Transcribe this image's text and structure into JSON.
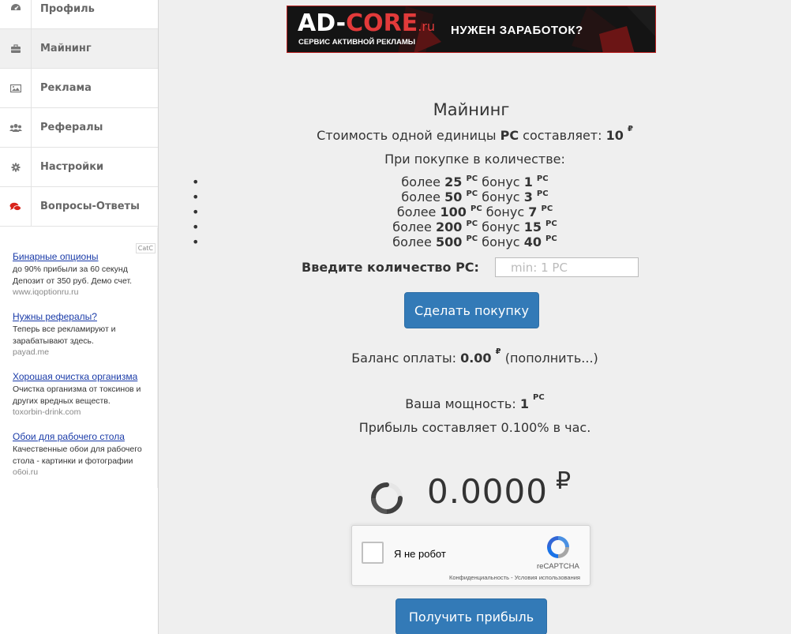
{
  "sidebar": {
    "items": [
      {
        "label": "Профиль",
        "icon": "dashboard-icon"
      },
      {
        "label": "Майнинг",
        "icon": "briefcase-icon"
      },
      {
        "label": "Реклама",
        "icon": "image-icon"
      },
      {
        "label": "Рефералы",
        "icon": "users-icon"
      },
      {
        "label": "Настройки",
        "icon": "gear-icon"
      },
      {
        "label": "Вопросы-Ответы",
        "icon": "chat-icon"
      }
    ]
  },
  "ads": {
    "tag": "CatC",
    "items": [
      {
        "title": "Бинарные опционы",
        "lines": [
          "до 90% прибыли за 60 секунд",
          "Депозит от 350 руб. Демо счет."
        ],
        "url": "www.iqoptionru.ru"
      },
      {
        "title": "Нужны рефералы?",
        "lines": [
          "Теперь все рекламируют и",
          "зарабатывают здесь."
        ],
        "url": "payad.me"
      },
      {
        "title": "Хорошая очистка организма",
        "lines": [
          "Очистка организма от токсинов и",
          "других вредных веществ."
        ],
        "url": "toxorbin-drink.com"
      },
      {
        "title": "Обои для рабочего стола",
        "lines": [
          "Качественные обои для рабочего",
          "стола - картинки и фотографии"
        ],
        "url": "o6oi.ru"
      }
    ]
  },
  "banner": {
    "logo_main": "AD-",
    "logo_accent": "CORE",
    "logo_tld": ".ru",
    "subtitle": "СЕРВИС АКТИВНОЙ РЕКЛАМЫ",
    "cta": "НУЖЕН ЗАРАБОТОК?"
  },
  "main": {
    "title": "Майнинг",
    "cost_prefix": "Стоимость одной единицы",
    "cost_unit": "PC",
    "cost_middle": "составляет:",
    "cost_value": "10",
    "currency": "₽",
    "purchase_intro": "При покупке в количестве:",
    "tier_more": "более",
    "tier_bonus": "бонус",
    "tier_unit": "PC",
    "tiers": [
      {
        "min": "25",
        "bonus": "1"
      },
      {
        "min": "50",
        "bonus": "3"
      },
      {
        "min": "100",
        "bonus": "7"
      },
      {
        "min": "200",
        "bonus": "15"
      },
      {
        "min": "500",
        "bonus": "40"
      }
    ],
    "qty_label": "Введите количество PC:",
    "qty_placeholder": "min: 1 PC",
    "buy_button": "Сделать покупку",
    "balance_label": "Баланс оплаты:",
    "balance_value": "0.00",
    "balance_link": "(пополнить...)",
    "power_label": "Ваша мощность:",
    "power_value": "1",
    "power_unit": "PC",
    "profit_rate": "Прибыль составляет 0.100% в час.",
    "accumulated": "0.0000",
    "get_profit_button": "Получить прибыль"
  },
  "recaptcha": {
    "label": "Я не робот",
    "brand": "reCAPTCHA",
    "links": "Конфиденциальность - Условия использования"
  },
  "colors": {
    "primary": "#337ab7",
    "banner_accent": "#e23a3a",
    "chat_icon": "#d9241b",
    "link": "#1a3ba8"
  }
}
